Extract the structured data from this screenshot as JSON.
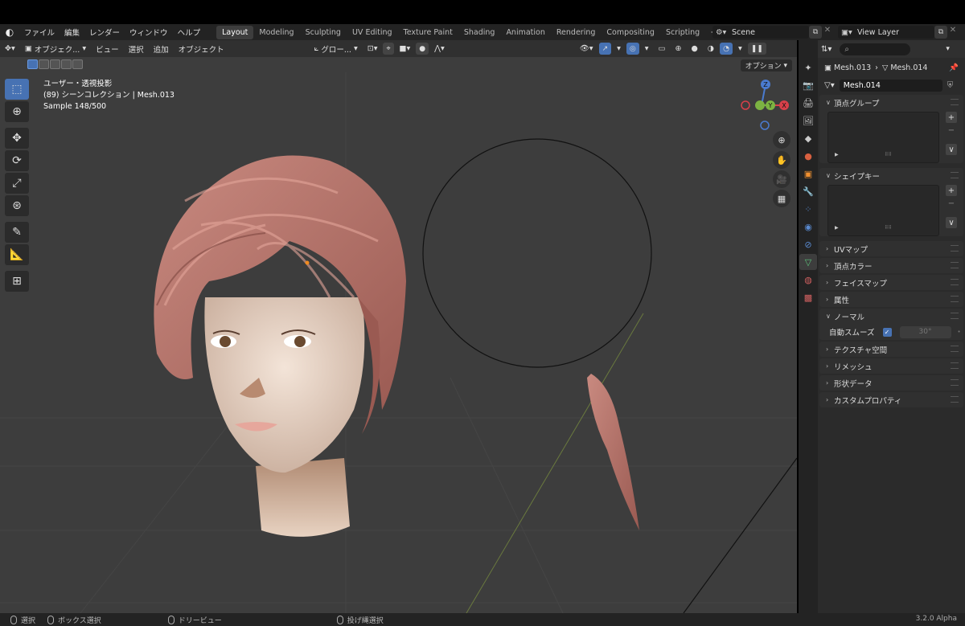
{
  "app": {
    "logo": "blender-logo",
    "version": "3.2.0 Alpha"
  },
  "menu": {
    "items": [
      "ファイル",
      "編集",
      "レンダー",
      "ウィンドウ",
      "ヘルプ"
    ]
  },
  "workspaces": {
    "tabs": [
      "Layout",
      "Modeling",
      "Sculpting",
      "UV Editing",
      "Texture Paint",
      "Shading",
      "Animation",
      "Rendering",
      "Compositing",
      "Scripting"
    ],
    "active": "Layout",
    "add": "+"
  },
  "scene": {
    "name": "Scene",
    "view_layer": "View Layer"
  },
  "viewport_header": {
    "mode": "オブジェク...",
    "menus": [
      "ビュー",
      "選択",
      "追加",
      "オブジェクト"
    ],
    "orientation": "グロー...",
    "options": "オプション"
  },
  "overlay": {
    "line1": "ユーザー・透視投影",
    "line2": "(89) シーンコレクション | Mesh.013",
    "line3": "Sample 148/500"
  },
  "gizmo": {
    "z": "Z",
    "y": "Y",
    "x": "X"
  },
  "properties": {
    "breadcrumb_object": "Mesh.013",
    "breadcrumb_data": "Mesh.014",
    "mesh_name": "Mesh.014",
    "panels": {
      "vertex_groups": "頂点グループ",
      "shape_keys": "シェイプキー",
      "uv_maps": "UVマップ",
      "vertex_colors": "頂点カラー",
      "face_maps": "フェイスマップ",
      "attributes": "属性",
      "normals": "ノーマル",
      "texture_space": "テクスチャ空間",
      "remesh": "リメッシュ",
      "geometry_data": "形状データ",
      "custom_properties": "カスタムプロパティ"
    },
    "auto_smooth_label": "自動スムーズ",
    "auto_smooth_angle": "30°"
  },
  "statusbar": {
    "select": "選択",
    "box_select": "ボックス選択",
    "dolly_view": "ドリービュー",
    "lasso_select": "投げ縄選択"
  },
  "colors": {
    "accent": "#4772b3",
    "hair": "#b06a62",
    "skin": "#eedbcc",
    "viewport_bg": "#3d3d3d"
  }
}
